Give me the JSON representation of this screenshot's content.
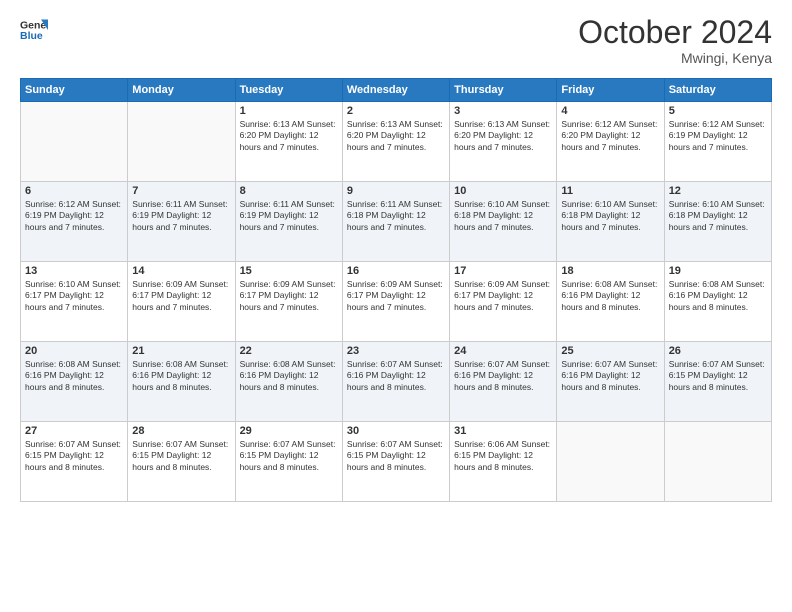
{
  "header": {
    "logo_line1": "General",
    "logo_line2": "Blue",
    "month": "October 2024",
    "location": "Mwingi, Kenya"
  },
  "weekdays": [
    "Sunday",
    "Monday",
    "Tuesday",
    "Wednesday",
    "Thursday",
    "Friday",
    "Saturday"
  ],
  "weeks": [
    [
      {
        "day": "",
        "info": ""
      },
      {
        "day": "",
        "info": ""
      },
      {
        "day": "1",
        "info": "Sunrise: 6:13 AM\nSunset: 6:20 PM\nDaylight: 12 hours and 7 minutes."
      },
      {
        "day": "2",
        "info": "Sunrise: 6:13 AM\nSunset: 6:20 PM\nDaylight: 12 hours and 7 minutes."
      },
      {
        "day": "3",
        "info": "Sunrise: 6:13 AM\nSunset: 6:20 PM\nDaylight: 12 hours and 7 minutes."
      },
      {
        "day": "4",
        "info": "Sunrise: 6:12 AM\nSunset: 6:20 PM\nDaylight: 12 hours and 7 minutes."
      },
      {
        "day": "5",
        "info": "Sunrise: 6:12 AM\nSunset: 6:19 PM\nDaylight: 12 hours and 7 minutes."
      }
    ],
    [
      {
        "day": "6",
        "info": "Sunrise: 6:12 AM\nSunset: 6:19 PM\nDaylight: 12 hours and 7 minutes."
      },
      {
        "day": "7",
        "info": "Sunrise: 6:11 AM\nSunset: 6:19 PM\nDaylight: 12 hours and 7 minutes."
      },
      {
        "day": "8",
        "info": "Sunrise: 6:11 AM\nSunset: 6:19 PM\nDaylight: 12 hours and 7 minutes."
      },
      {
        "day": "9",
        "info": "Sunrise: 6:11 AM\nSunset: 6:18 PM\nDaylight: 12 hours and 7 minutes."
      },
      {
        "day": "10",
        "info": "Sunrise: 6:10 AM\nSunset: 6:18 PM\nDaylight: 12 hours and 7 minutes."
      },
      {
        "day": "11",
        "info": "Sunrise: 6:10 AM\nSunset: 6:18 PM\nDaylight: 12 hours and 7 minutes."
      },
      {
        "day": "12",
        "info": "Sunrise: 6:10 AM\nSunset: 6:18 PM\nDaylight: 12 hours and 7 minutes."
      }
    ],
    [
      {
        "day": "13",
        "info": "Sunrise: 6:10 AM\nSunset: 6:17 PM\nDaylight: 12 hours and 7 minutes."
      },
      {
        "day": "14",
        "info": "Sunrise: 6:09 AM\nSunset: 6:17 PM\nDaylight: 12 hours and 7 minutes."
      },
      {
        "day": "15",
        "info": "Sunrise: 6:09 AM\nSunset: 6:17 PM\nDaylight: 12 hours and 7 minutes."
      },
      {
        "day": "16",
        "info": "Sunrise: 6:09 AM\nSunset: 6:17 PM\nDaylight: 12 hours and 7 minutes."
      },
      {
        "day": "17",
        "info": "Sunrise: 6:09 AM\nSunset: 6:17 PM\nDaylight: 12 hours and 7 minutes."
      },
      {
        "day": "18",
        "info": "Sunrise: 6:08 AM\nSunset: 6:16 PM\nDaylight: 12 hours and 8 minutes."
      },
      {
        "day": "19",
        "info": "Sunrise: 6:08 AM\nSunset: 6:16 PM\nDaylight: 12 hours and 8 minutes."
      }
    ],
    [
      {
        "day": "20",
        "info": "Sunrise: 6:08 AM\nSunset: 6:16 PM\nDaylight: 12 hours and 8 minutes."
      },
      {
        "day": "21",
        "info": "Sunrise: 6:08 AM\nSunset: 6:16 PM\nDaylight: 12 hours and 8 minutes."
      },
      {
        "day": "22",
        "info": "Sunrise: 6:08 AM\nSunset: 6:16 PM\nDaylight: 12 hours and 8 minutes."
      },
      {
        "day": "23",
        "info": "Sunrise: 6:07 AM\nSunset: 6:16 PM\nDaylight: 12 hours and 8 minutes."
      },
      {
        "day": "24",
        "info": "Sunrise: 6:07 AM\nSunset: 6:16 PM\nDaylight: 12 hours and 8 minutes."
      },
      {
        "day": "25",
        "info": "Sunrise: 6:07 AM\nSunset: 6:16 PM\nDaylight: 12 hours and 8 minutes."
      },
      {
        "day": "26",
        "info": "Sunrise: 6:07 AM\nSunset: 6:15 PM\nDaylight: 12 hours and 8 minutes."
      }
    ],
    [
      {
        "day": "27",
        "info": "Sunrise: 6:07 AM\nSunset: 6:15 PM\nDaylight: 12 hours and 8 minutes."
      },
      {
        "day": "28",
        "info": "Sunrise: 6:07 AM\nSunset: 6:15 PM\nDaylight: 12 hours and 8 minutes."
      },
      {
        "day": "29",
        "info": "Sunrise: 6:07 AM\nSunset: 6:15 PM\nDaylight: 12 hours and 8 minutes."
      },
      {
        "day": "30",
        "info": "Sunrise: 6:07 AM\nSunset: 6:15 PM\nDaylight: 12 hours and 8 minutes."
      },
      {
        "day": "31",
        "info": "Sunrise: 6:06 AM\nSunset: 6:15 PM\nDaylight: 12 hours and 8 minutes."
      },
      {
        "day": "",
        "info": ""
      },
      {
        "day": "",
        "info": ""
      }
    ]
  ]
}
